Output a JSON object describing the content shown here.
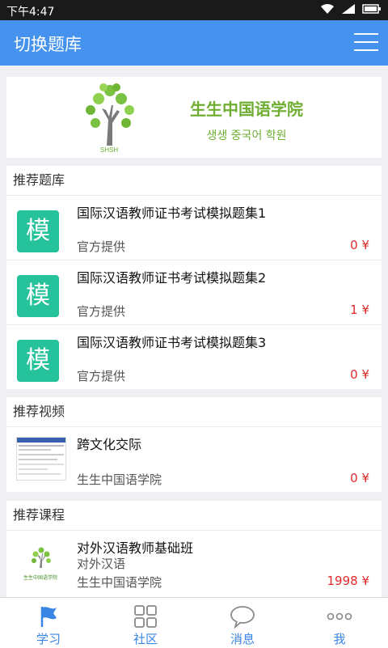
{
  "status": {
    "time": "下午4:47"
  },
  "header": {
    "title": "切换题库"
  },
  "banner": {
    "name_cn": "生生中国语学院",
    "name_kr": "생생 중국어 학원",
    "logo_text": "SHSH"
  },
  "bank": {
    "section_title": "推荐题库",
    "items": [
      {
        "icon_char": "模",
        "title": "国际汉语教师证书考试模拟题集1",
        "provider": "官方提供",
        "price": "0 ¥"
      },
      {
        "icon_char": "模",
        "title": "国际汉语教师证书考试模拟题集2",
        "provider": "官方提供",
        "price": "1 ¥"
      },
      {
        "icon_char": "模",
        "title": "国际汉语教师证书考试模拟题集3",
        "provider": "官方提供",
        "price": "0 ¥"
      }
    ]
  },
  "video": {
    "section_title": "推荐视频",
    "items": [
      {
        "title": "跨文化交际",
        "provider": "生生中国语学院",
        "price": "0 ¥"
      }
    ]
  },
  "course": {
    "section_title": "推荐课程",
    "items": [
      {
        "title": "对外汉语教师基础班",
        "subtitle": "对外汉语",
        "provider": "生生中国语学院",
        "price": "1998 ¥",
        "thumb_text": "生生中国语学院"
      }
    ]
  },
  "tabs": [
    {
      "label": "学习",
      "icon": "flag-icon"
    },
    {
      "label": "社区",
      "icon": "grid-icon"
    },
    {
      "label": "消息",
      "icon": "chat-bubble-icon"
    },
    {
      "label": "我",
      "icon": "more-dots-icon"
    }
  ],
  "colors": {
    "brand": "#4593ee",
    "accent_green": "#26c29b",
    "price_red": "#e4292b",
    "logo_green": "#6fae33"
  }
}
